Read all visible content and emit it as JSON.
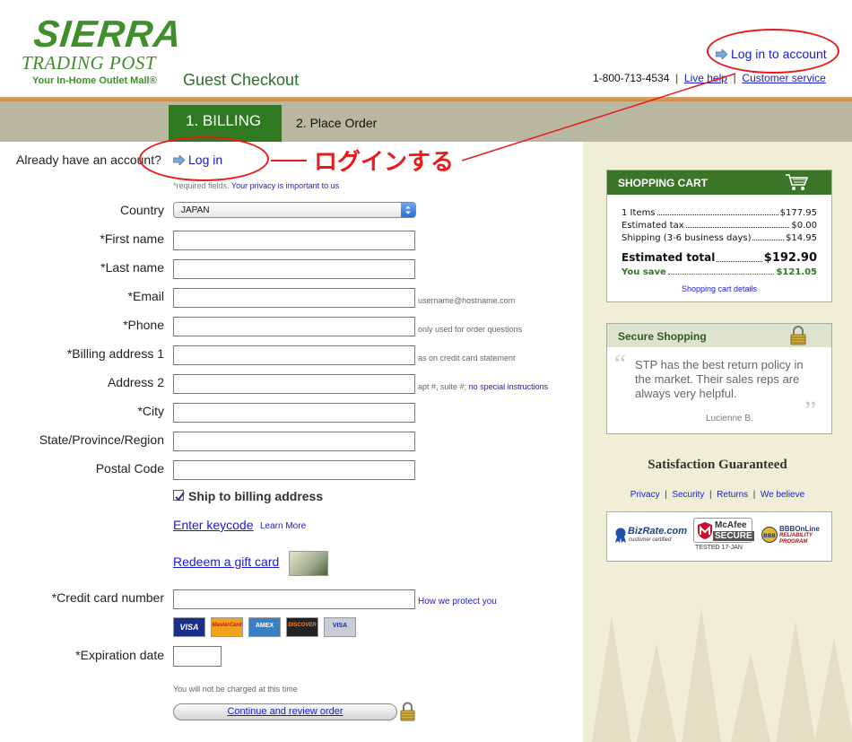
{
  "header": {
    "logo_main": "SIERRA",
    "logo_sub": "TRADING POST",
    "logo_tagline": "Your In-Home Outlet Mall®",
    "title": "Guest Checkout",
    "phone": "1-800-713-4534",
    "live_help": "Live help",
    "customer_service": "Customer service",
    "login_account": "Log in to account"
  },
  "steps": {
    "billing": "1. BILLING",
    "place_order": "2. Place Order"
  },
  "account": {
    "prompt": "Already have an account?",
    "login": "Log in",
    "annotation": "ログインする"
  },
  "form": {
    "required_note": "*required fields.",
    "privacy_link": "Your privacy is important to us",
    "country_label": "Country",
    "country_value": "JAPAN",
    "fields": [
      {
        "label": "*First name",
        "hint": ""
      },
      {
        "label": "*Last name",
        "hint": ""
      },
      {
        "label": "*Email",
        "hint": "username@hostname.com"
      },
      {
        "label": "*Phone",
        "hint": "only used for order questions"
      },
      {
        "label": "*Billing address 1",
        "hint": "as on credit card statement"
      },
      {
        "label": "Address 2",
        "hint": "apt #, suite #;",
        "hint_link": "no special instructions"
      },
      {
        "label": "*City",
        "hint": ""
      },
      {
        "label": "State/Province/Region",
        "hint": ""
      },
      {
        "label": "Postal Code",
        "hint": ""
      }
    ],
    "ship_to_billing": "Ship to billing address",
    "ship_checked": true,
    "enter_keycode": "Enter keycode",
    "learn_more": "Learn More",
    "redeem_gift": "Redeem a gift card",
    "cc_label": "*Credit card number",
    "cc_protect": "How we protect you",
    "cards": [
      "VISA",
      "MasterCard",
      "AMEX",
      "DISCOVER",
      "VISA"
    ],
    "exp_label": "*Expiration date",
    "not_charged": "You will not be charged at this time",
    "continue_button": "Continue and review order"
  },
  "cart": {
    "title": "SHOPPING CART",
    "items_label": "1 Items",
    "items_value": "$177.95",
    "tax_label": "Estimated tax",
    "tax_value": "$0.00",
    "shipping_label": "Shipping (3-6 business days)",
    "shipping_value": "$14.95",
    "total_label": "Estimated total",
    "total_value": "$192.90",
    "save_label": "You save",
    "save_value": "$121.05",
    "details_link": "Shopping cart details"
  },
  "secure": {
    "title": "Secure Shopping",
    "quote": "STP has the best return policy in the market. Their sales reps are always very helpful.",
    "author": "Lucienne B."
  },
  "guarantee": "Satisfaction Guaranteed",
  "policy_links": [
    "Privacy",
    "Security",
    "Returns",
    "We believe"
  ],
  "badges": {
    "bizrate": "BizRate.com",
    "bizrate_sub": "customer certified",
    "mcafee": "McAfee",
    "mcafee_secure": "SECURE",
    "mcafee_tested": "TESTED 17-JAN",
    "bbb": "BBBOnLine",
    "bbb_sub": "RELIABILITY PROGRAM"
  },
  "colors": {
    "brand_green": "#3f8f2a",
    "tab_green": "#2f7a21",
    "link_blue": "#1a1ad0",
    "annotation_red": "#e81a1a",
    "sidebar_bg": "#f1eed8"
  }
}
